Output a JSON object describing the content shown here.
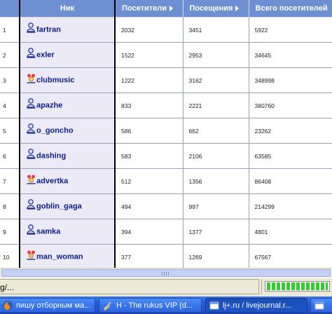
{
  "table": {
    "headers": {
      "idx": "",
      "nick": "Ник",
      "visitors": "Посетители",
      "visits": "Посещения",
      "total": "Всего посетителей"
    },
    "rows": [
      {
        "n": "1",
        "icon": "user-icon",
        "nick": "fartran",
        "visitors": "2032",
        "visits": "3451",
        "total": "5922"
      },
      {
        "n": "2",
        "icon": "user-icon",
        "nick": "exler",
        "visitors": "1522",
        "visits": "2953",
        "total": "34645"
      },
      {
        "n": "3",
        "icon": "community-icon",
        "nick": "clubmusic",
        "visitors": "1222",
        "visits": "3162",
        "total": "348998"
      },
      {
        "n": "4",
        "icon": "user-icon",
        "nick": "apazhe",
        "visitors": "833",
        "visits": "2221",
        "total": "380760"
      },
      {
        "n": "5",
        "icon": "user-icon",
        "nick": "o_goncho",
        "visitors": "586",
        "visits": "662",
        "total": "23262"
      },
      {
        "n": "6",
        "icon": "user-icon",
        "nick": "dashing",
        "visitors": "583",
        "visits": "2106",
        "total": "63585"
      },
      {
        "n": "7",
        "icon": "community-icon",
        "nick": "advertka",
        "visitors": "512",
        "visits": "1356",
        "total": "86408"
      },
      {
        "n": "8",
        "icon": "user-icon",
        "nick": "goblin_gaga",
        "visitors": "494",
        "visits": "997",
        "total": "214299"
      },
      {
        "n": "9",
        "icon": "user-icon",
        "nick": "samka",
        "visitors": "394",
        "visits": "1377",
        "total": "4801"
      },
      {
        "n": "10",
        "icon": "community-icon",
        "nick": "man_woman",
        "visitors": "377",
        "visits": "1269",
        "total": "67567"
      }
    ]
  },
  "statusbar": {
    "text": "g/...",
    "progress_fraction": 1.0
  },
  "taskbar": {
    "buttons": [
      {
        "label": "пишу отборным ма...",
        "icon": "firefox-icon",
        "active": false
      },
      {
        "label": "H - The rukus VIP (d...",
        "icon": "tool-icon",
        "active": false
      },
      {
        "label": "lj+.ru / livejournal.r...",
        "icon": "browser-window-icon",
        "active": true
      }
    ]
  },
  "colors": {
    "header_bg": "#6f8fd3",
    "nick_column_bg": "#eceaf6",
    "user_link": "#0c1e8c",
    "taskbar": "#2758cf"
  }
}
